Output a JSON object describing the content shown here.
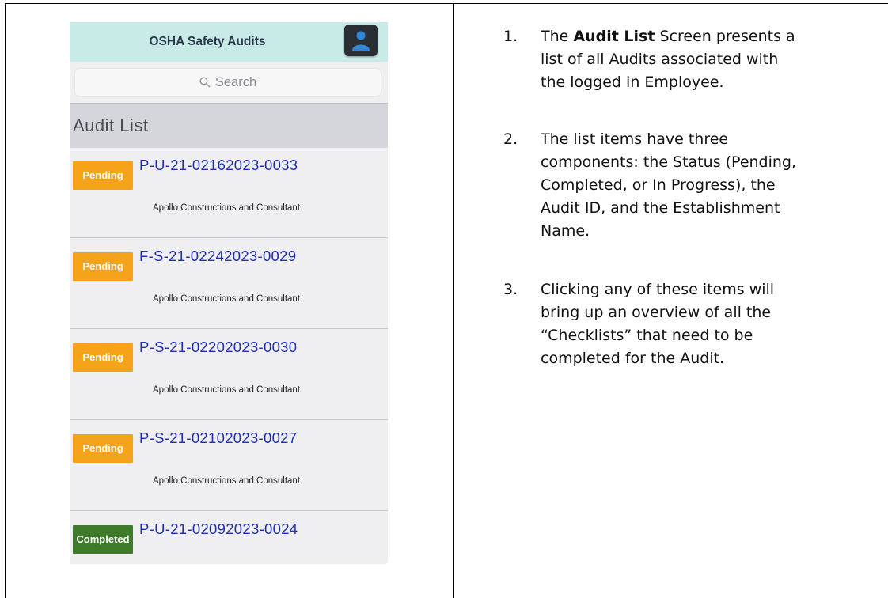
{
  "app": {
    "title": "OSHA Safety Audits",
    "profile_icon": "user-icon",
    "search_placeholder": "Search",
    "section_title": "Audit List"
  },
  "audits": [
    {
      "status": "Pending",
      "id": "P-U-21-02162023-0033",
      "establishment": "Apollo Constructions and Consultant"
    },
    {
      "status": "Pending",
      "id": "F-S-21-02242023-0029",
      "establishment": "Apollo Constructions and Consultant"
    },
    {
      "status": "Pending",
      "id": "P-S-21-02202023-0030",
      "establishment": "Apollo Constructions and Consultant"
    },
    {
      "status": "Pending",
      "id": "P-S-21-02102023-0027",
      "establishment": "Apollo Constructions and Consultant"
    },
    {
      "status": "Completed",
      "id": "P-U-21-02092023-0024",
      "establishment": ""
    }
  ],
  "colors": {
    "pending": "#f5a31b",
    "completed": "#3f7a2b",
    "audit_id": "#1f2fb0",
    "header_bg": "#c9ebe8"
  },
  "instructions": [
    {
      "num": "1.",
      "bold": "Audit List",
      "lines": [
        "The ",
        " Screen presents a",
        "list of all Audits associated with",
        "the logged in Employee."
      ]
    },
    {
      "num": "2.",
      "lines": [
        "The list items have three",
        "components: the Status (Pending,",
        "Completed, or In Progress), the",
        "Audit ID, and the Establishment",
        "Name."
      ]
    },
    {
      "num": "3.",
      "lines": [
        "Clicking any of these items will",
        "bring up an overview of all the",
        "“Checklists” that need to be",
        "completed for the Audit."
      ]
    }
  ]
}
